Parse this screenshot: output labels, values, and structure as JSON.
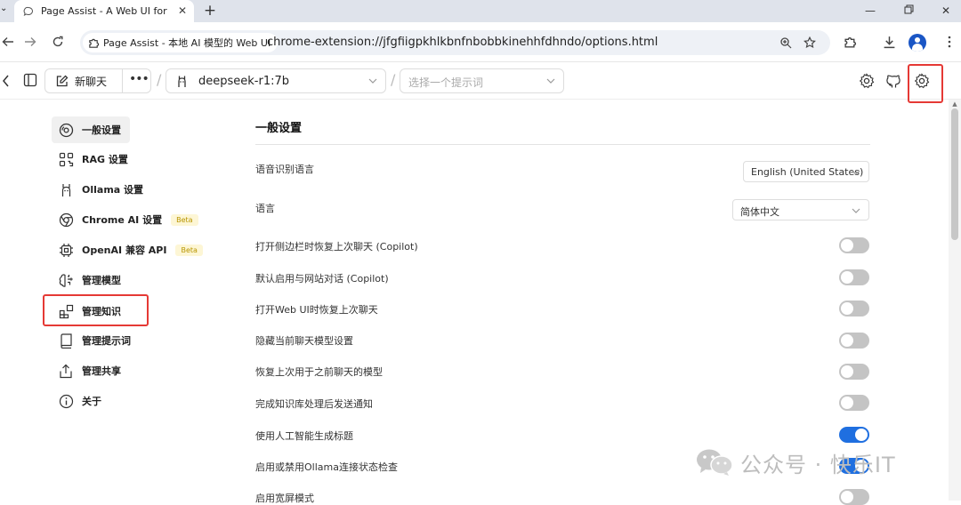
{
  "browser": {
    "tab_title": "Page Assist - A Web UI for Lo",
    "site_chip": "Page Assist - 本地 AI 模型的 Web UI",
    "url": "chrome-extension://jfgfiigpkhlkbnfnbobbkinehhfdhndo/options.html"
  },
  "header": {
    "new_chat_label": "新聊天",
    "model_name": "deepseek-r1:7b",
    "prompt_placeholder": "选择一个提示词"
  },
  "sidebar": {
    "items": [
      {
        "label": "一般设置",
        "icon": "settings-circle-icon",
        "active": true
      },
      {
        "label": "RAG 设置",
        "icon": "scan-icon"
      },
      {
        "label": "Ollama 设置",
        "icon": "llama-icon"
      },
      {
        "label": "Chrome AI 设置",
        "icon": "chrome-icon",
        "badge": "Beta"
      },
      {
        "label": "OpenAI 兼容 API",
        "icon": "cpu-icon",
        "badge": "Beta"
      },
      {
        "label": "管理模型",
        "icon": "brain-icon"
      },
      {
        "label": "管理知识",
        "icon": "blocks-icon"
      },
      {
        "label": "管理提示词",
        "icon": "book-icon"
      },
      {
        "label": "管理共享",
        "icon": "share-icon"
      },
      {
        "label": "关于",
        "icon": "info-icon"
      }
    ]
  },
  "main": {
    "section_title": "一般设置",
    "speech_lang_label": "语音识别语言",
    "speech_lang_value": "English (United States)",
    "language_label": "语言",
    "language_value": "简体中文",
    "toggles": [
      {
        "label": "打开侧边栏时恢复上次聊天 (Copilot)",
        "on": false
      },
      {
        "label": "默认启用与网站对话 (Copilot)",
        "on": false
      },
      {
        "label": "打开Web UI时恢复上次聊天",
        "on": false
      },
      {
        "label": "隐藏当前聊天模型设置",
        "on": false
      },
      {
        "label": "恢复上次用于之前聊天的模型",
        "on": false
      },
      {
        "label": "完成知识库处理后发送通知",
        "on": false
      },
      {
        "label": "使用人工智能生成标题",
        "on": true
      },
      {
        "label": "启用或禁用Ollama连接状态检查",
        "on": true
      },
      {
        "label": "启用宽屏模式",
        "on": false
      }
    ]
  },
  "watermark": {
    "text": "公众号 · 快乐IT"
  },
  "colors": {
    "accent": "#1f6fe0",
    "highlight": "#e53935"
  }
}
